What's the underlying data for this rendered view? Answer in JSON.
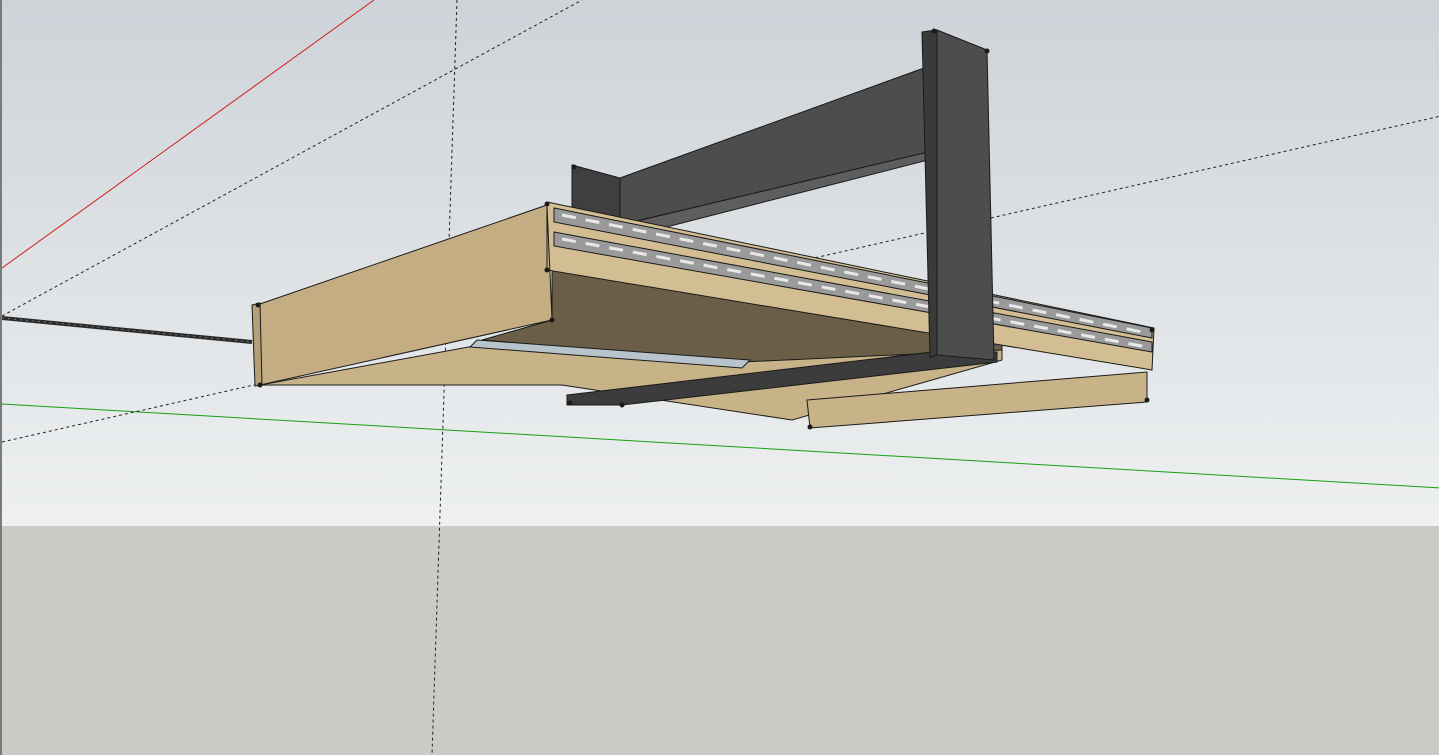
{
  "colors": {
    "sky_top": "#cdd3d8",
    "sky_bottom": "#eef0f1",
    "ground": "#cbcbc6",
    "red_axis": "#d21e1e",
    "green_axis": "#14a014",
    "guide": "#222222",
    "wood": "#c8b287",
    "wood_front": "#c4ad83",
    "wood_shadow": "#6b5e47",
    "steel": "#4d4d4d",
    "steel_dark": "#3c3c3c",
    "edge": "#1a1a1a",
    "slot": "#e8e8e8"
  },
  "icons": {
    "cable": "threaded-rod-icon",
    "rails": "drawer-slide-rail-icon"
  }
}
